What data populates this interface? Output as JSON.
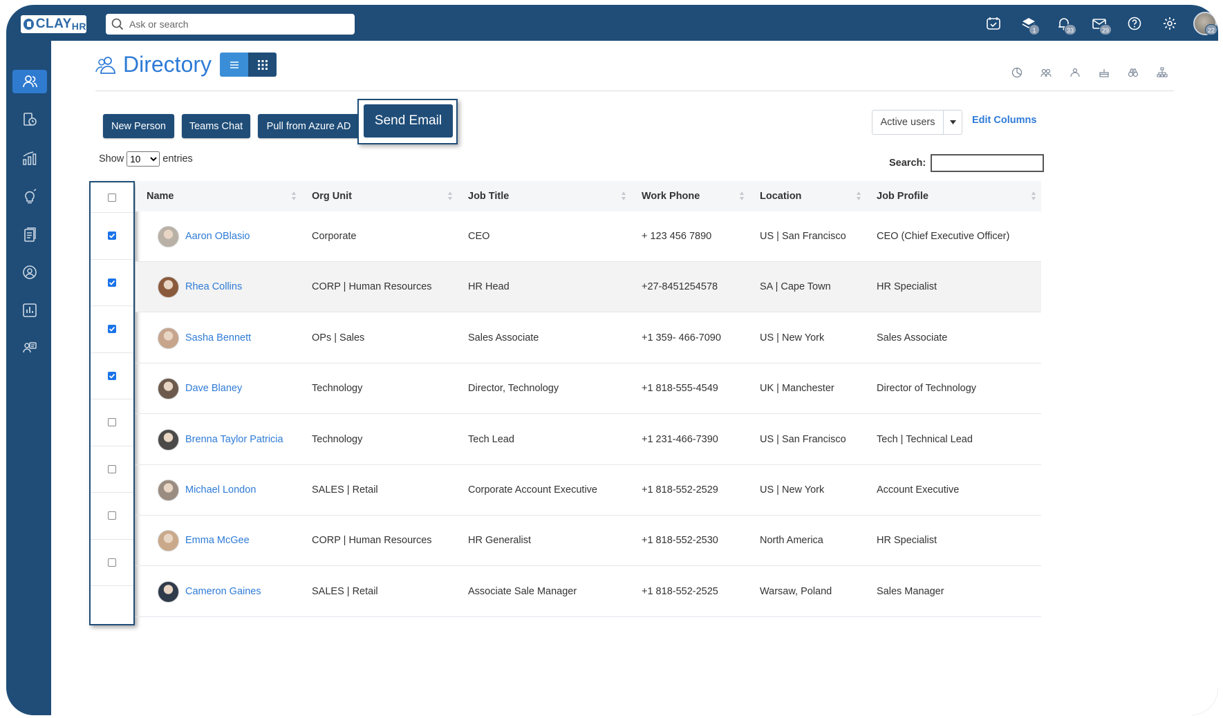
{
  "app": {
    "logo_main": "CLAY",
    "logo_sub": "HR",
    "search_placeholder": "Ask or search"
  },
  "top_icons": [
    {
      "name": "calendar-clock-icon",
      "badge": ""
    },
    {
      "name": "layers-icon",
      "badge": "1"
    },
    {
      "name": "bell-icon",
      "badge": "33"
    },
    {
      "name": "mail-icon",
      "badge": "29"
    },
    {
      "name": "help-icon",
      "badge": ""
    },
    {
      "name": "settings-icon",
      "badge": ""
    }
  ],
  "user_badge": "22",
  "sidebar": {
    "items": [
      {
        "name": "people-icon",
        "active": true
      },
      {
        "name": "time-off-icon",
        "active": false
      },
      {
        "name": "analytics-icon",
        "active": false
      },
      {
        "name": "ideas-icon",
        "active": false
      },
      {
        "name": "documents-icon",
        "active": false
      },
      {
        "name": "profile-search-icon",
        "active": false
      },
      {
        "name": "reports-icon",
        "active": false
      },
      {
        "name": "support-icon",
        "active": false
      }
    ]
  },
  "page": {
    "title": "Directory"
  },
  "toolbar": {
    "new_person": "New Person",
    "teams_chat": "Teams Chat",
    "pull_azure": "Pull from Azure AD",
    "send_email": "Send Email",
    "filter": "Active users",
    "edit_columns": "Edit Columns"
  },
  "table_controls": {
    "show_label": "Show",
    "entries_value": "10",
    "entries_label": "entries",
    "search_label": "Search:"
  },
  "columns": [
    "Name",
    "Org Unit",
    "Job Title",
    "Work Phone",
    "Location",
    "Job Profile"
  ],
  "rows": [
    {
      "name": "Aaron OBlasio",
      "org": "Corporate",
      "title": "CEO",
      "phone": "+ 123 456 7890",
      "location": "US | San Francisco",
      "profile": "CEO (Chief Executive Officer)",
      "checked": true
    },
    {
      "name": "Rhea Collins",
      "org": "CORP | Human Resources",
      "title": "HR Head",
      "phone": "+27-8451254578",
      "location": "SA | Cape Town",
      "profile": "HR Specialist",
      "checked": true
    },
    {
      "name": "Sasha Bennett",
      "org": "OPs | Sales",
      "title": "Sales Associate",
      "phone": "+1 359- 466-7090",
      "location": "US | New York",
      "profile": "Sales Associate",
      "checked": true
    },
    {
      "name": "Dave Blaney",
      "org": "Technology",
      "title": "Director, Technology",
      "phone": "+1 818-555-4549",
      "location": "UK | Manchester",
      "profile": "Director of Technology",
      "checked": true
    },
    {
      "name": "Brenna Taylor Patricia",
      "org": "Technology",
      "title": "Tech Lead",
      "phone": "+1 231-466-7390",
      "location": "US | San Francisco",
      "profile": "Tech | Technical Lead",
      "checked": false
    },
    {
      "name": "Michael London",
      "org": "SALES | Retail",
      "title": "Corporate Account Executive",
      "phone": "+1 818-552-2529",
      "location": "US | New York",
      "profile": "Account Executive",
      "checked": false
    },
    {
      "name": "Emma McGee",
      "org": "CORP | Human Resources",
      "title": "HR Generalist",
      "phone": "+1 818-552-2530",
      "location": "North America",
      "profile": "HR Specialist",
      "checked": false
    },
    {
      "name": "Cameron Gaines",
      "org": "SALES | Retail",
      "title": "Associate Sale Manager",
      "phone": "+1 818-552-2525",
      "location": "Warsaw, Poland",
      "profile": "Sales Manager",
      "checked": false
    }
  ],
  "colors": {
    "brand_navy": "#1f4d78",
    "accent_blue": "#2e7bd6",
    "checkbox_blue": "#1a73e8"
  }
}
